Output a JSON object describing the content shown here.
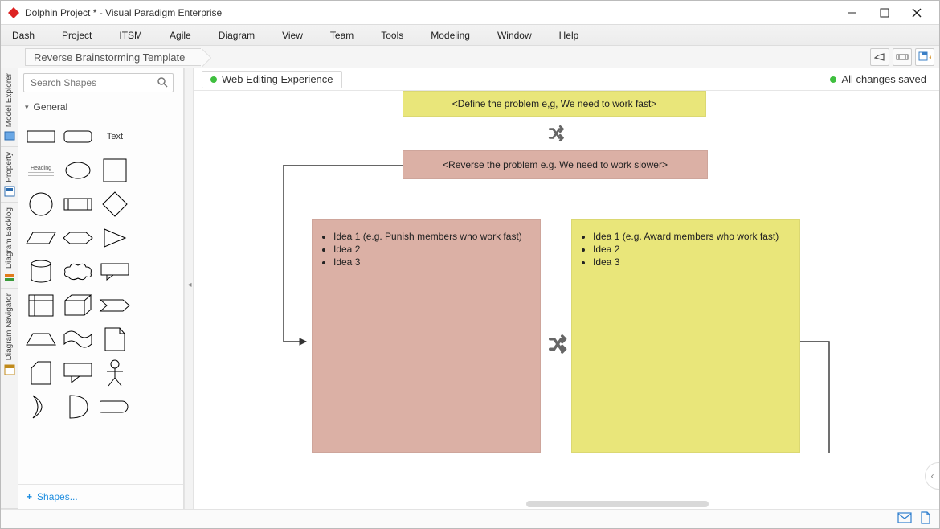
{
  "window": {
    "title": "Dolphin Project * - Visual Paradigm Enterprise"
  },
  "menu": [
    "Dash",
    "Project",
    "ITSM",
    "Agile",
    "Diagram",
    "View",
    "Team",
    "Tools",
    "Modeling",
    "Window",
    "Help"
  ],
  "breadcrumb": "Reverse Brainstorming Template",
  "sidebar_tabs": [
    {
      "label": "Model Explorer"
    },
    {
      "label": "Property"
    },
    {
      "label": "Diagram Backlog"
    },
    {
      "label": "Diagram Navigator"
    }
  ],
  "shapes": {
    "search_placeholder": "Search Shapes",
    "category": "General",
    "text_label": "Text",
    "heading_label": "Heading",
    "footer": "Shapes..."
  },
  "status": {
    "left": "Web Editing Experience",
    "right": "All changes saved"
  },
  "diagram": {
    "define": "<Define the problem e,g, We need to work fast>",
    "reverse": "<Reverse the problem e.g. We need to work slower>",
    "left_ideas": [
      "Idea 1 (e.g. Punish members who work fast)",
      "Idea 2",
      "Idea 3"
    ],
    "right_ideas": [
      "Idea 1 (e.g. Award members who work fast)",
      "Idea 2",
      "Idea 3"
    ]
  }
}
